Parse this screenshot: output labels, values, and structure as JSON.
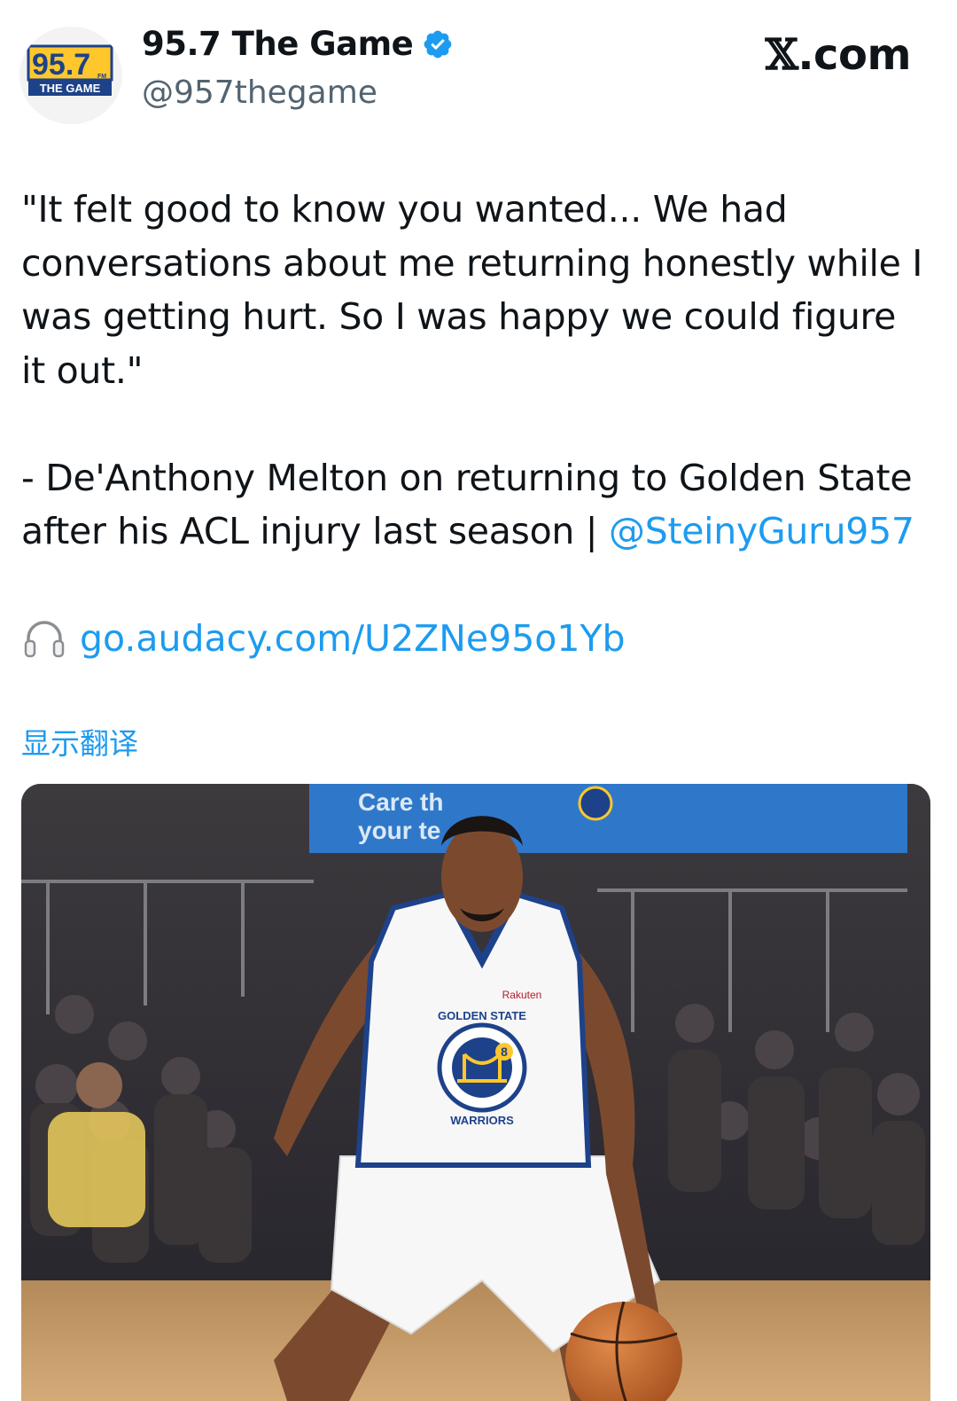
{
  "account": {
    "avatar_line1": "95.7",
    "avatar_fm": "FM",
    "avatar_line2": "THE GAME",
    "display_name": "95.7 The Game",
    "verified_icon": "verified-badge-icon",
    "handle": "@957thegame"
  },
  "brand": {
    "x_mark": "𝕏",
    "suffix": ".com"
  },
  "tweet": {
    "quote": "\"It felt good to know you wanted... We had conversations about me returning honestly while I was getting hurt. So I was happy we could figure it out.\"",
    "attribution": "- De'Anthony Melton on returning to Golden State after his ACL injury last season | ",
    "mention": "@SteinyGuru957",
    "link_icon": "headphones-icon",
    "link": "go.audacy.com/U2ZNe95o1Yb",
    "translate": "显示翻译"
  },
  "photo": {
    "banner_text_1": "Care th",
    "banner_text_2": "your te",
    "jersey_sponsor": "Rakuten",
    "jersey_team_top": "GOLDEN STATE",
    "jersey_team_bottom": "WARRIORS",
    "jersey_number": "8",
    "colors": {
      "warriors_blue": "#1d428a",
      "warriors_gold": "#ffc72c",
      "court": "#c79a62"
    }
  },
  "colors": {
    "link": "#1d9bf0",
    "muted": "#536471",
    "text": "#0f1419"
  }
}
